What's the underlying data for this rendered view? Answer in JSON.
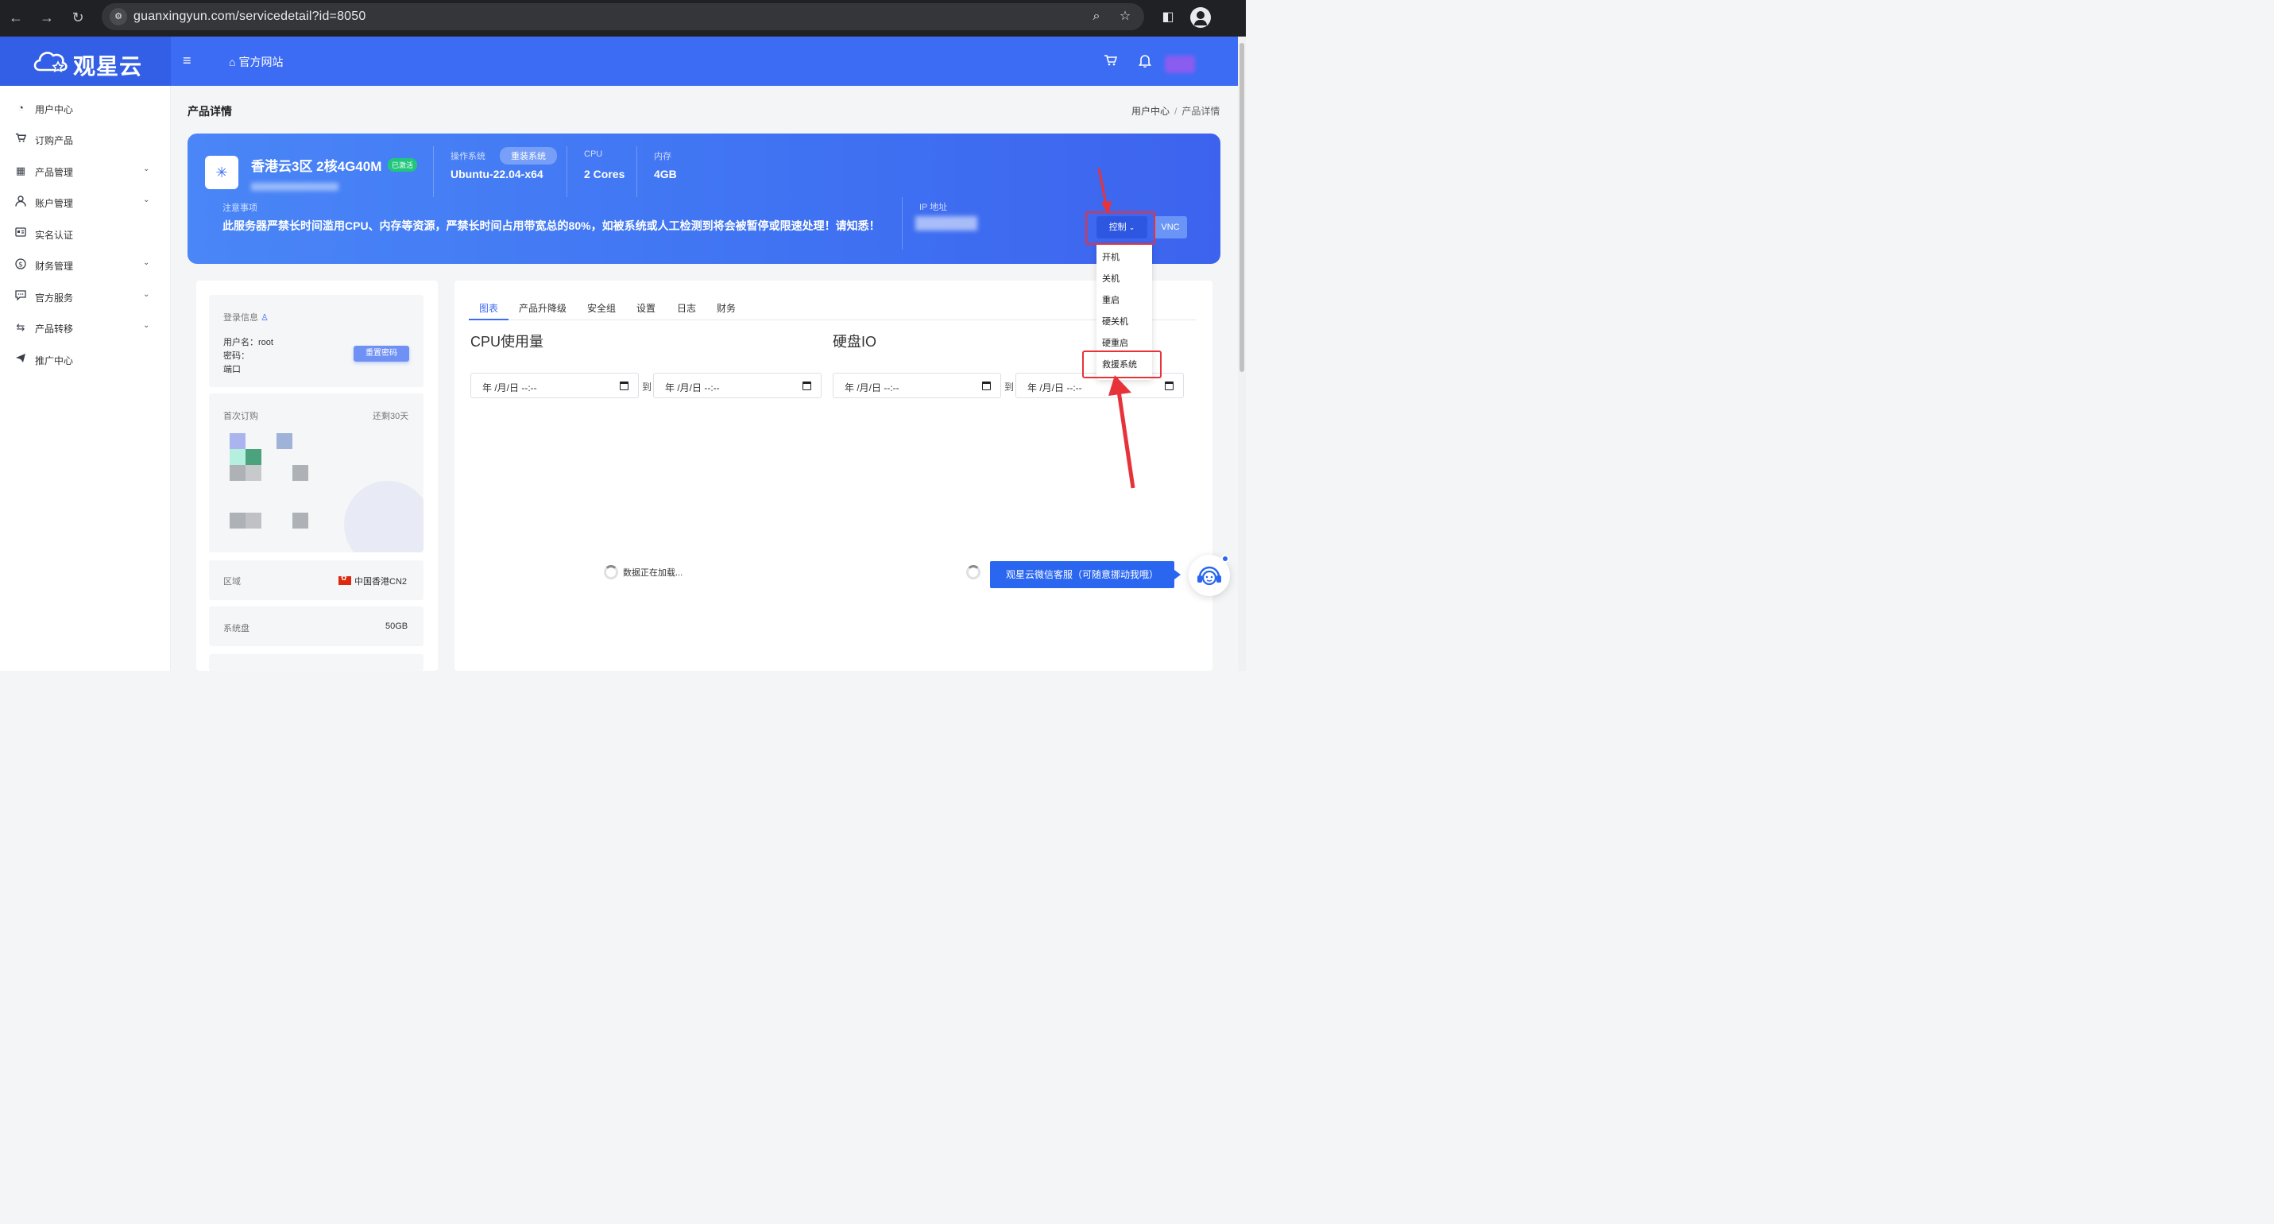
{
  "browser": {
    "url": "guanxingyun.com/servicedetail?id=8050",
    "icons": [
      "back-icon",
      "forward-icon",
      "reload-icon",
      "site-settings-icon",
      "zoom-icon",
      "star-icon",
      "sidebar-icon",
      "profile-icon"
    ]
  },
  "header": {
    "brand": "观星云",
    "official_site": "官方网站",
    "icons": [
      "menu-icon",
      "home-icon",
      "cart-icon",
      "bell-icon"
    ]
  },
  "sidebar": {
    "items": [
      {
        "label": "用户中心",
        "icon": "palette-icon",
        "has_children": false
      },
      {
        "label": "订购产品",
        "icon": "cart-icon",
        "has_children": false
      },
      {
        "label": "产品管理",
        "icon": "grid-icon",
        "has_children": true
      },
      {
        "label": "账户管理",
        "icon": "user-icon",
        "has_children": true
      },
      {
        "label": "实名认证",
        "icon": "id-card-icon",
        "has_children": false
      },
      {
        "label": "财务管理",
        "icon": "dollar-icon",
        "has_children": true
      },
      {
        "label": "官方服务",
        "icon": "chat-icon",
        "has_children": true
      },
      {
        "label": "产品转移",
        "icon": "transfer-icon",
        "has_children": true
      },
      {
        "label": "推广中心",
        "icon": "send-icon",
        "has_children": false
      }
    ]
  },
  "page": {
    "title": "产品详情",
    "breadcrumb": [
      "用户中心",
      "产品详情"
    ]
  },
  "banner": {
    "product_name": "香港云3区 2核4G40M",
    "status_badge": "已激活",
    "os_label": "操作系统",
    "reinstall_label": "重装系统",
    "os_value": "Ubuntu-22.04-x64",
    "cpu_label": "CPU",
    "cpu_value": "2 Cores",
    "mem_label": "内存",
    "mem_value": "4GB",
    "notice_label": "注意事项",
    "notice_text": "此服务器严禁长时间滥用CPU、内存等资源，严禁长时间占用带宽总的80%，如被系统或人工检测到将会被暂停或限速处理！请知悉！",
    "ip_label": "IP 地址",
    "control_label": "控制",
    "vnc_label": "VNC"
  },
  "control_menu": {
    "items": [
      "开机",
      "关机",
      "重启",
      "硬关机",
      "硬重启",
      "救援系统"
    ]
  },
  "left_panel": {
    "login_title": "登录信息",
    "username_label": "用户名：",
    "username_value": "root",
    "password_label": "密码：",
    "port_label": "端口",
    "reset_password": "重置密码",
    "first_order_label": "首次订购",
    "remaining": "还剩30天",
    "region_label": "区域",
    "region_value": "中国香港CN2",
    "system_disk_label": "系统盘",
    "system_disk_value": "50GB"
  },
  "right_panel": {
    "tabs": [
      "图表",
      "产品升降级",
      "安全组",
      "设置",
      "日志",
      "财务"
    ],
    "active_tab": "图表",
    "cpu_title": "CPU使用量",
    "disk_title": "硬盘IO",
    "date_placeholder": "年 /月/日 --:--",
    "to": "到",
    "loading": "数据正在加载..."
  },
  "customer_service": {
    "label": "观星云微信客服（可随意挪动我哦）"
  },
  "colors": {
    "brand": "#3d6cf4",
    "annotation": "#e8323a",
    "active_badge": "#20c77a"
  }
}
